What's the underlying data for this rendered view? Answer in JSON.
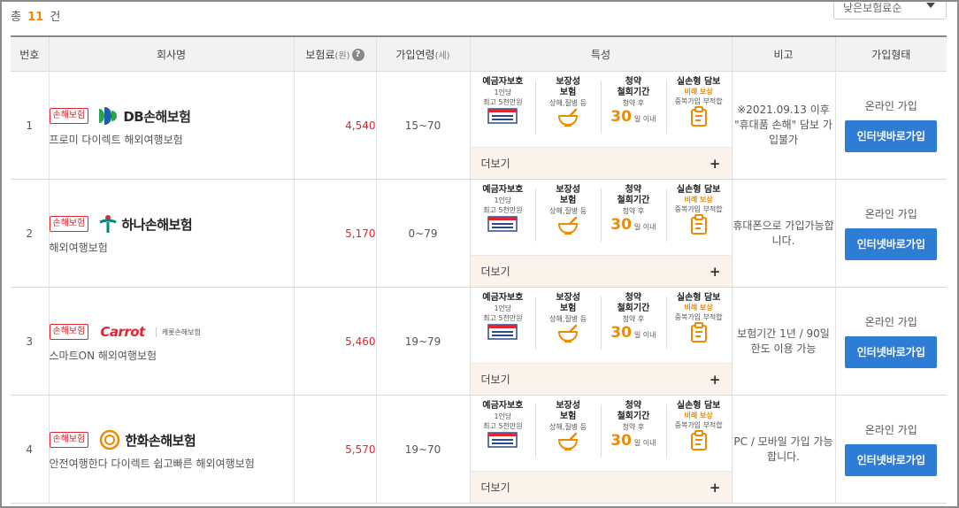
{
  "header": {
    "total_prefix": "총",
    "total_count": "11",
    "total_suffix": "건",
    "sort_value": "낮은보험료순"
  },
  "table": {
    "columns": {
      "num": "번호",
      "company": "회사명",
      "premium": "보험료",
      "premium_unit": "(원)",
      "age": "가입연령",
      "age_unit": "(세)",
      "features": "특성",
      "note": "비고",
      "join": "가입형태"
    },
    "feature_labels": {
      "f1_title": "예금자보호",
      "f1_line1": "1인당",
      "f1_line2": "최고 5천만원",
      "f2_title1": "보장성",
      "f2_title2": "보험",
      "f2_line1": "상해,질병 등",
      "f3_title1": "청약",
      "f3_title2": "철회기간",
      "f3_line1": "청약 후",
      "f3_big": "30",
      "f3_unit": "일 이내",
      "f4_title": "실손형 담보",
      "f4_red": "비례 보상",
      "f4_line1": "중복가입 부적합"
    },
    "more_label": "더보기",
    "plus_glyph": "+",
    "rows": [
      {
        "num": "1",
        "badge": "손해보험",
        "logo": "DB손해보험",
        "product": "프로미 다이렉트 해외여행보험",
        "premium": "4,540",
        "age": "15~70",
        "note": "※2021.09.13 이후 \"휴대품 손해\" 담보 가입불가",
        "join_type": "온라인 가입",
        "join_btn": "인터넷바로가입"
      },
      {
        "num": "2",
        "badge": "손해보험",
        "logo": "하나손해보험",
        "product": "해외여행보험",
        "premium": "5,170",
        "age": "0~79",
        "note": "휴대폰으로 가입가능합니다.",
        "join_type": "온라인 가입",
        "join_btn": "인터넷바로가입"
      },
      {
        "num": "3",
        "badge": "손해보험",
        "logo": "Carrot",
        "logo_sub": "캐롯손해보험",
        "product": "스마트ON 해외여행보험",
        "premium": "5,460",
        "age": "19~79",
        "note": "보험기간 1년 / 90일 한도 이용 가능",
        "join_type": "온라인 가입",
        "join_btn": "인터넷바로가입"
      },
      {
        "num": "4",
        "badge": "손해보험",
        "logo": "한화손해보험",
        "product": "안전여행한다 다이렉트 쉽고빠른 해외여행보험",
        "premium": "5,570",
        "age": "19~70",
        "note": "PC / 모바일 가입 가능합니다.",
        "join_type": "온라인 가입",
        "join_btn": "인터넷바로가입"
      }
    ]
  },
  "colors": {
    "accent_orange": "#f08a00",
    "price_red": "#e0262e",
    "button_blue": "#2f7cd4",
    "more_bg": "#fbf3ea"
  }
}
